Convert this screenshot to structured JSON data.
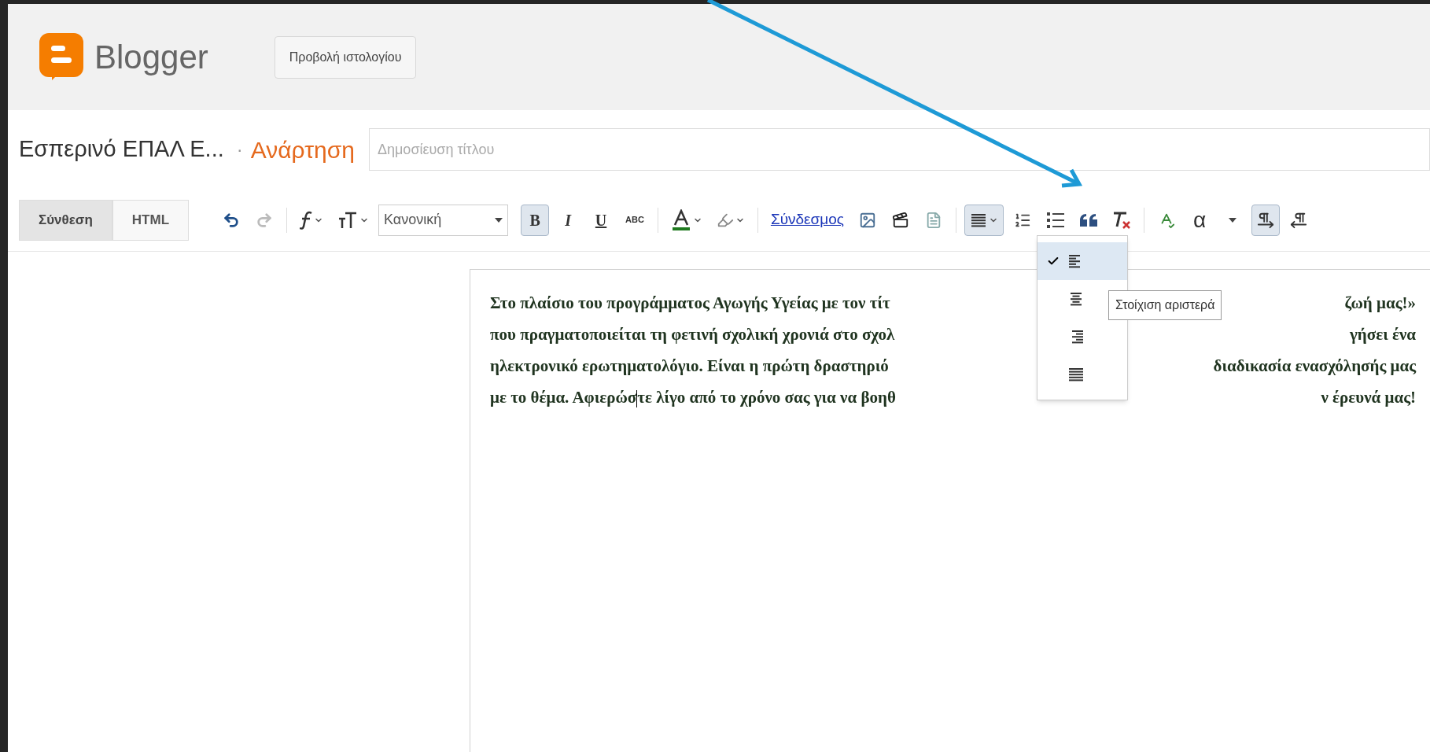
{
  "header": {
    "logo_text": "Blogger",
    "view_blog_button": "Προβολή ιστολογίου"
  },
  "post_bar": {
    "blog_name": "Εσπερινό ΕΠΑΛ Ε...",
    "separator": "·",
    "section": "Ανάρτηση",
    "title_field": {
      "placeholder": "Δημοσίευση τίτλου"
    }
  },
  "mode_tabs": [
    {
      "label": "Σύνθεση",
      "selected": true
    },
    {
      "label": "HTML",
      "selected": false
    }
  ],
  "toolbar": [
    {
      "kind": "undo",
      "disabled": false
    },
    {
      "kind": "redo",
      "disabled": true
    },
    {
      "kind": "sep"
    },
    {
      "kind": "font",
      "dropdown": true
    },
    {
      "kind": "font-size",
      "dropdown": true
    },
    {
      "kind": "select",
      "value": "Κανονική"
    },
    {
      "kind": "bold",
      "text": "B",
      "pressed": true
    },
    {
      "kind": "italic",
      "text": "I",
      "pressed": false
    },
    {
      "kind": "underline",
      "text": "U",
      "pressed": false
    },
    {
      "kind": "strike",
      "text": "ABC",
      "pressed": false
    },
    {
      "kind": "sep"
    },
    {
      "kind": "text-color",
      "dropdown": true,
      "color": "#1f7a1f"
    },
    {
      "kind": "highlight",
      "dropdown": true
    },
    {
      "kind": "sep"
    },
    {
      "kind": "link",
      "text": "Σύνδεσμος"
    },
    {
      "kind": "image"
    },
    {
      "kind": "video"
    },
    {
      "kind": "page-break"
    },
    {
      "kind": "sep"
    },
    {
      "kind": "align",
      "dropdown": true,
      "pressed": true
    },
    {
      "kind": "numbered-list"
    },
    {
      "kind": "bullet-list"
    },
    {
      "kind": "quote"
    },
    {
      "kind": "clear-format"
    },
    {
      "kind": "sep"
    },
    {
      "kind": "spellcheck"
    },
    {
      "kind": "letter",
      "text": "α",
      "pressed": false
    },
    {
      "kind": "caret"
    },
    {
      "kind": "ltr",
      "pressed": true
    },
    {
      "kind": "rtl",
      "pressed": false
    }
  ],
  "editor": {
    "lines": [
      {
        "left": "Στο πλαίσιο του προγράμματος Αγωγής Υγείας με τον τίτ",
        "right": "ζωή μας!»"
      },
      {
        "left": "που πραγματοποιείται τη φετινή σχολική χρονιά στο σχολ",
        "right": "γήσει ένα"
      },
      {
        "left": "ηλεκτρονικό ερωτηματολόγιο.  Είναι η πρώτη δραστηριό",
        "right": "διαδικασία ενασχόλησής μας"
      },
      {
        "left": "με το θέμα. Αφιερώσ",
        "left_after_cursor": "τε λίγο από το χρόνο σας για να βοηθ",
        "right": "ν έρευνά μας!"
      }
    ]
  },
  "align_menu": {
    "items": [
      {
        "kind": "left",
        "selected": true
      },
      {
        "kind": "center",
        "selected": false
      },
      {
        "kind": "right",
        "selected": false
      },
      {
        "kind": "justify",
        "selected": false
      }
    ],
    "tooltip": "Στοίχιση αριστερά"
  }
}
